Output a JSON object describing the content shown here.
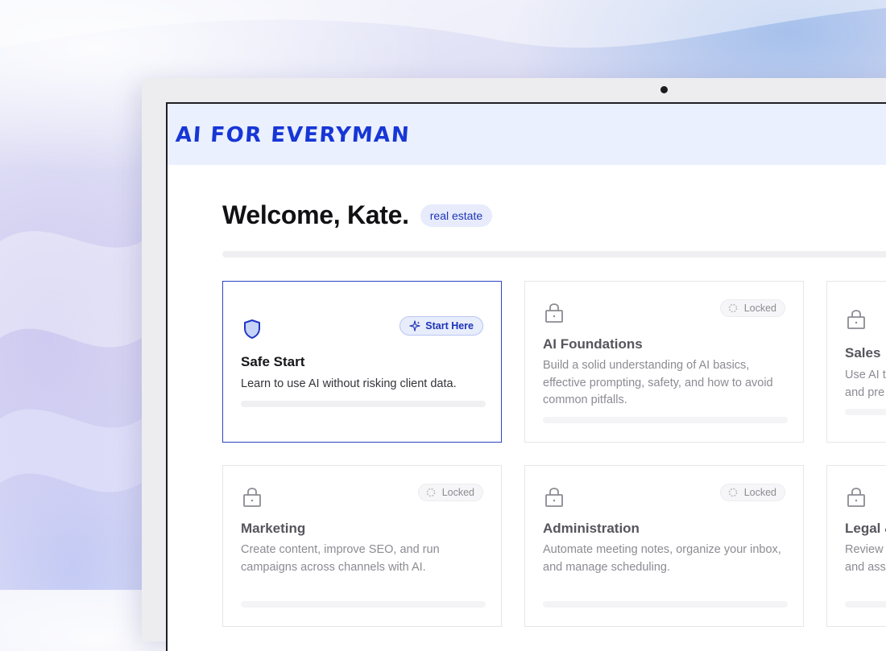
{
  "app": {
    "logo": "AI FOR EVERYMAN"
  },
  "welcome": {
    "greeting": "Welcome, Kate.",
    "industry_badge": "real estate"
  },
  "colors": {
    "accent": "#1736d6",
    "badge_bg": "#e7ebfb",
    "card_active_border": "#2d44c8"
  },
  "modules": [
    {
      "title": "Safe Start",
      "description": "Learn to use AI without risking client data.",
      "badge": "Start Here",
      "icon": "shield-icon",
      "status": "active"
    },
    {
      "title": "AI Foundations",
      "description": "Build a solid understanding of AI basics, effective prompting, safety, and how to avoid common pitfalls.",
      "badge": "Locked",
      "icon": "lock-icon",
      "status": "locked"
    },
    {
      "title": "Sales",
      "description": "Use AI t",
      "description_line2": "and pre",
      "icon": "lock-icon",
      "status": "locked"
    },
    {
      "title": "Marketing",
      "description": "Create content, improve SEO, and run campaigns across channels with AI.",
      "badge": "Locked",
      "icon": "lock-icon",
      "status": "locked"
    },
    {
      "title": "Administration",
      "description": "Automate meeting notes, organize your inbox, and manage scheduling.",
      "badge": "Locked",
      "icon": "lock-icon",
      "status": "locked"
    },
    {
      "title": "Legal &",
      "description": "Review",
      "description_line2": "and ass",
      "icon": "lock-icon",
      "status": "locked"
    }
  ]
}
